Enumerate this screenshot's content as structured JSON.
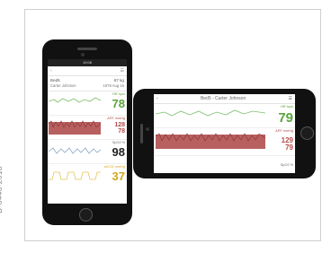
{
  "figure_id": "D-6446-2018",
  "portrait": {
    "status_time": "10:08",
    "bed": "Bed5",
    "weight": "67 kg",
    "patient": "Carter Johnson",
    "dob": "1978 Aug 16",
    "tiles": [
      {
        "label": "HR bpm",
        "value": "78",
        "color": "#5aa43e"
      },
      {
        "label": "ART mmHg",
        "value_top": "128",
        "value_bottom": "78",
        "color": "#b34a4a"
      },
      {
        "label": "SpO2 %",
        "value": "98",
        "color": "#222222"
      },
      {
        "label": "etCO2 mmHg",
        "value": "37",
        "color": "#d6a51a"
      }
    ]
  },
  "landscape": {
    "title": "Bed5 - Carter Johnson",
    "tiles": [
      {
        "label": "HR bpm",
        "value": "79",
        "color": "#5aa43e"
      },
      {
        "label": "ART mmHg",
        "value_top": "129",
        "value_bottom": "79",
        "color": "#b34a4a"
      },
      {
        "label": "SpO2 %",
        "value": ""
      }
    ]
  },
  "icons": {
    "back": "chevron-left-icon",
    "menu": "hamburger-menu-icon"
  }
}
